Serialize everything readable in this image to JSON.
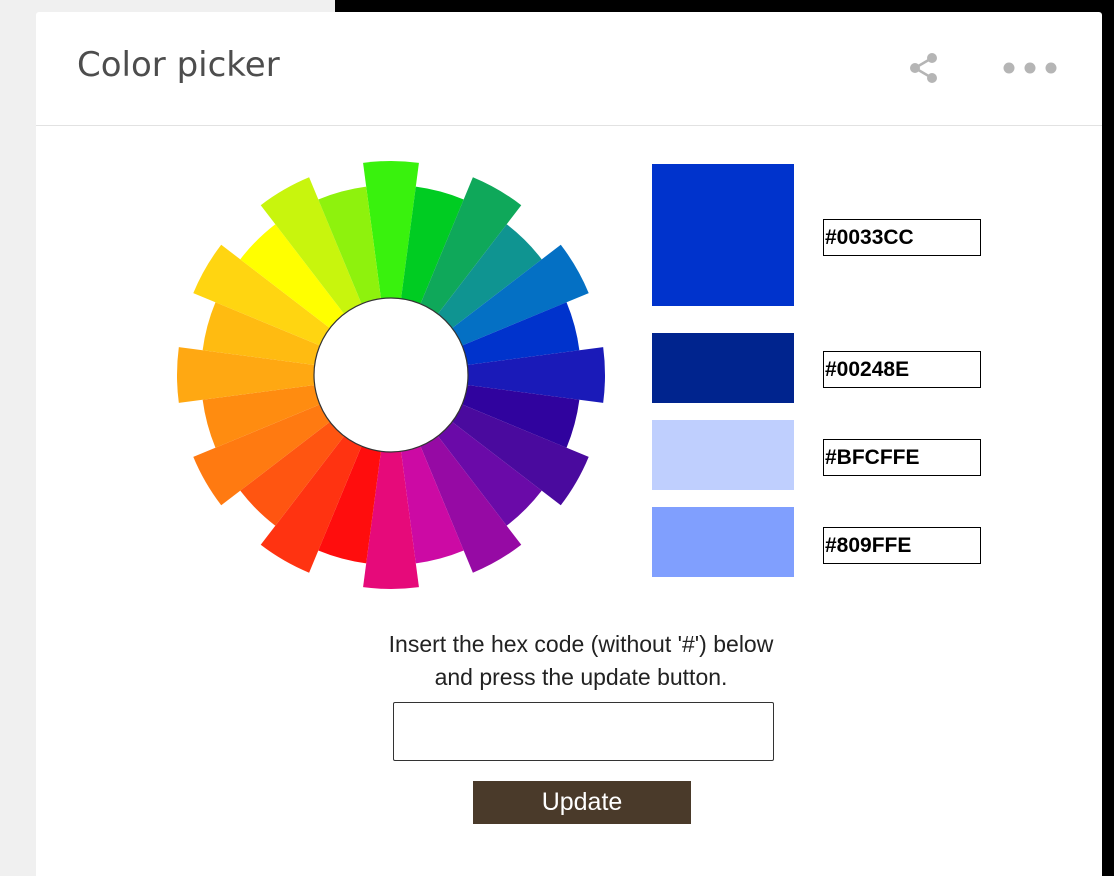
{
  "header": {
    "title": "Color picker",
    "share_icon": "share-icon",
    "more_icon": "more-options-icon"
  },
  "wheel": {
    "segment_count": 24,
    "outer_radii": [
      214,
      190,
      214,
      190,
      214,
      190,
      214,
      190,
      214,
      190,
      214,
      190,
      214,
      190,
      214,
      190,
      214,
      190,
      214,
      190,
      214,
      190,
      214,
      190
    ],
    "colors": [
      "#39f20d",
      "#00cc22",
      "#0fa85a",
      "#0f9491",
      "#0470c4",
      "#0033cc",
      "#1a1ab8",
      "#30039e",
      "#4a0a9e",
      "#6a0aa8",
      "#960aa4",
      "#cc0aa4",
      "#e60a7a",
      "#ff0d0d",
      "#ff3311",
      "#ff5511",
      "#ff7a11",
      "#ff8c10",
      "#ffa812",
      "#ffbb11",
      "#ffd511",
      "#ffff00",
      "#c8f50d",
      "#8ef20d"
    ]
  },
  "swatches": [
    {
      "hex": "#0033CC",
      "color": "#0033cc"
    },
    {
      "hex": "#00248E",
      "color": "#00248e"
    },
    {
      "hex": "#BFCFFE",
      "color": "#bfcffe"
    },
    {
      "hex": "#809FFE",
      "color": "#809ffe"
    }
  ],
  "instructions": {
    "line1": "Insert the hex code (without '#') below",
    "line2": "and press the update button."
  },
  "input": {
    "value": "",
    "placeholder": ""
  },
  "update_button": {
    "label": "Update",
    "color": "#4a3a2a"
  },
  "colors": {
    "page_background": "#000000",
    "left_panel": "#f0f0f0",
    "card": "#ffffff",
    "header_divider": "#e2e2e2",
    "icon": "#b5b5b5",
    "title": "#4d4d4d"
  }
}
